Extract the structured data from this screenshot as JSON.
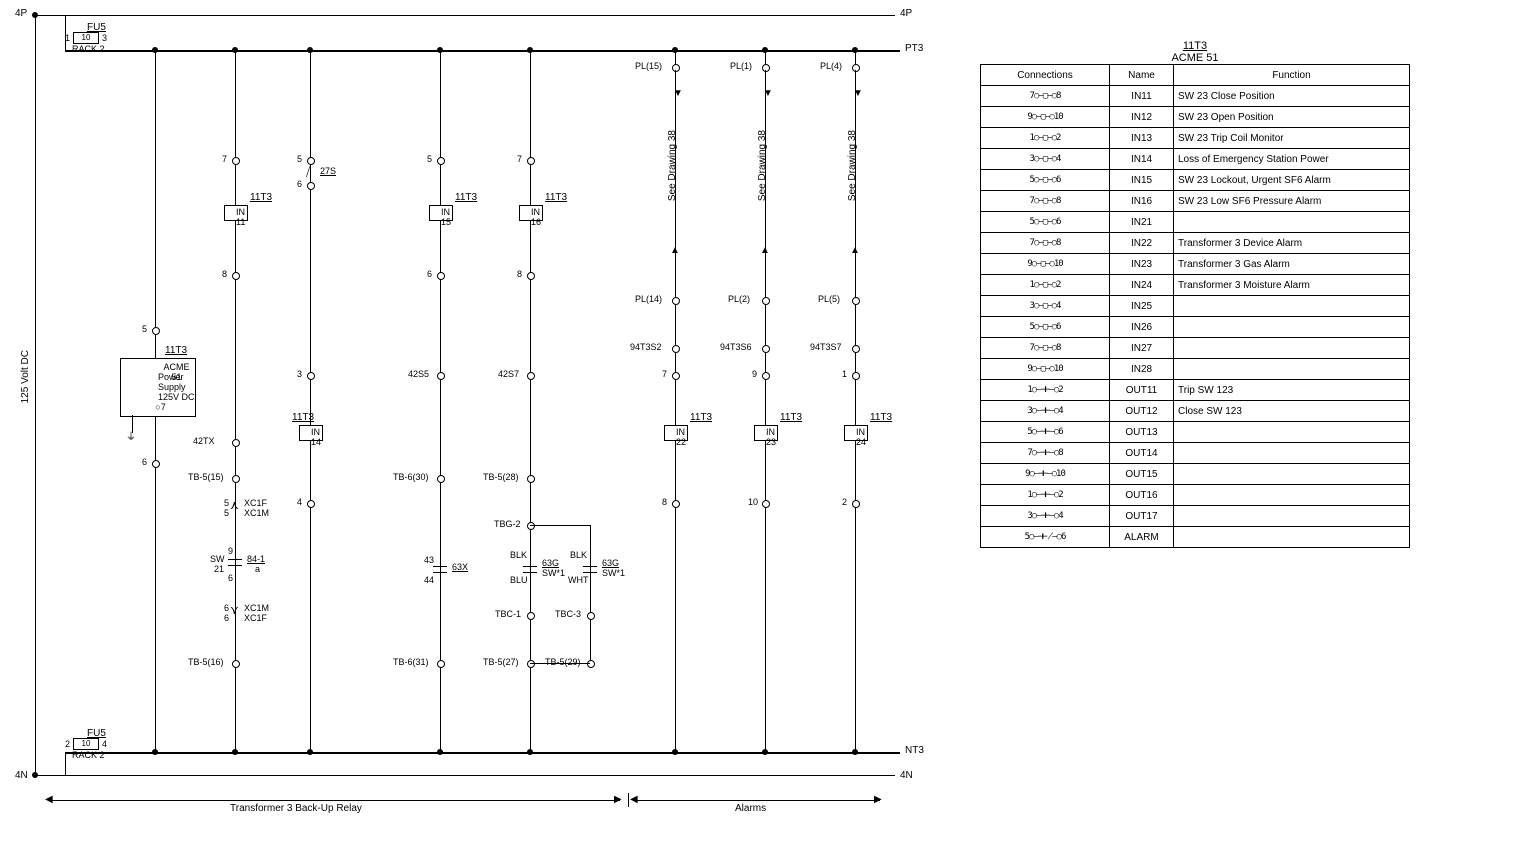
{
  "bus": {
    "top": "4P",
    "bot": "4N",
    "pt": "PT3",
    "nt": "NT3"
  },
  "fuse": {
    "label": "FU5",
    "val": "10",
    "rack": "RACK 2"
  },
  "side": {
    "volt": "125 Volt DC"
  },
  "ps": {
    "hdr": "11T3",
    "l1": "ACME 51",
    "l2": "Power",
    "l3": "Supply",
    "l4": "125V DC",
    "pin": "7"
  },
  "in11": {
    "h": "11T3",
    "t": "IN",
    "n": "11"
  },
  "in14": {
    "h": "11T3",
    "t": "IN",
    "n": "14"
  },
  "in15": {
    "h": "11T3",
    "t": "IN",
    "n": "15"
  },
  "in16": {
    "h": "11T3",
    "t": "IN",
    "n": "16"
  },
  "in22": {
    "h": "11T3",
    "t": "IN",
    "n": "22"
  },
  "in23": {
    "h": "11T3",
    "t": "IN",
    "n": "23"
  },
  "in24": {
    "h": "11T3",
    "t": "IN",
    "n": "24"
  },
  "vert": {
    "a": {
      "t5": "5",
      "t6": "6"
    },
    "b": {
      "t7": "7",
      "t8": "8",
      "tb1": "TB-5(15)",
      "xc1f": "XC1F",
      "xc1m": "XC1M",
      "sw": "SW",
      "num21": "21",
      "fan": "84-1",
      "sub9": "9",
      "sub6": "6",
      "xc1m2": "XC1M",
      "xc1f2": "XC1F",
      "tb2": "TB-5(16)",
      "fortytwotx": "42TX"
    },
    "c": {
      "t5": "5",
      "t6": "6",
      "t3": "3",
      "t4": "4",
      "dev": "27S"
    },
    "d": {
      "t5": "5",
      "t6": "6",
      "s42": "42S5",
      "tb1": "TB-6(30)",
      "num43": "43",
      "num44": "44",
      "x63": "63X",
      "tb2": "TB-6(31)"
    },
    "e": {
      "t7": "7",
      "t8": "8",
      "s42": "42S7",
      "tb1": "TB-5(28)",
      "tbg2": "TBG-2",
      "blk": "BLK",
      "blu": "BLU",
      "dev": "63G",
      "sw": "SW*1",
      "tbc1": "TBC-1",
      "tb2": "TB-5(27)"
    },
    "e2": {
      "blk": "BLK",
      "wht": "WHT",
      "dev": "63G",
      "sw": "SW*1",
      "tbc3": "TBC-3",
      "tb": "TB-5(29)"
    },
    "f": {
      "pl1": "PL(15)",
      "see": "See Drawing 38",
      "pl2": "PL(14)",
      "dev": "94T3S2",
      "t7": "7",
      "t8": "8"
    },
    "g": {
      "pl1": "PL(1)",
      "see": "See Drawing 38",
      "pl2": "PL(2)",
      "dev": "94T3S6",
      "t9": "9",
      "t10": "10"
    },
    "h": {
      "pl1": "PL(4)",
      "see": "See Drawing 38",
      "pl2": "PL(5)",
      "dev": "94T3S7",
      "t1": "1",
      "t2": "2"
    }
  },
  "section": {
    "left": "Transformer 3 Back-Up Relay",
    "right": "Alarms"
  },
  "table": {
    "title_top": "11T3",
    "title": "ACME 51",
    "h1": "Connections",
    "h2": "Name",
    "h3": "Function",
    "rows": [
      {
        "c": "7○—▢—○8",
        "n": "IN11",
        "f": "SW 23 Close Position"
      },
      {
        "c": "9○—▢—○10",
        "n": "IN12",
        "f": "SW 23 Open Position"
      },
      {
        "c": "1○—▢—○2",
        "n": "IN13",
        "f": "SW 23 Trip Coil Monitor"
      },
      {
        "c": "3○—▢—○4",
        "n": "IN14",
        "f": "Loss of Emergency Station Power"
      },
      {
        "c": "5○—▢—○6",
        "n": "IN15",
        "f": "SW 23 Lockout, Urgent SF6 Alarm"
      },
      {
        "c": "7○—▢—○8",
        "n": "IN16",
        "f": "SW 23 Low SF6 Pressure Alarm"
      },
      {
        "c": "5○—▢—○6",
        "n": "IN21",
        "f": ""
      },
      {
        "c": "7○—▢—○8",
        "n": "IN22",
        "f": "Transformer 3 Device Alarm"
      },
      {
        "c": "9○—▢—○10",
        "n": "IN23",
        "f": "Transformer 3 Gas Alarm"
      },
      {
        "c": "1○—▢—○2",
        "n": "IN24",
        "f": "Transformer 3 Moisture Alarm"
      },
      {
        "c": "3○—▢—○4",
        "n": "IN25",
        "f": ""
      },
      {
        "c": "5○—▢—○6",
        "n": "IN26",
        "f": ""
      },
      {
        "c": "7○—▢—○8",
        "n": "IN27",
        "f": ""
      },
      {
        "c": "9○—▢—○10",
        "n": "IN28",
        "f": ""
      },
      {
        "c": "1○—⊣⊢—○2",
        "n": "OUT11",
        "f": "Trip SW 123"
      },
      {
        "c": "3○—⊣⊢—○4",
        "n": "OUT12",
        "f": "Close SW 123"
      },
      {
        "c": "5○—⊣⊢—○6",
        "n": "OUT13",
        "f": ""
      },
      {
        "c": "7○—⊣⊢—○8",
        "n": "OUT14",
        "f": ""
      },
      {
        "c": "9○—⊣⊢—○10",
        "n": "OUT15",
        "f": ""
      },
      {
        "c": "1○—⊣⊢—○2",
        "n": "OUT16",
        "f": ""
      },
      {
        "c": "3○—⊣⊢—○4",
        "n": "OUT17",
        "f": ""
      },
      {
        "c": "5○—⊣⊬—○6",
        "n": "ALARM",
        "f": ""
      }
    ]
  }
}
